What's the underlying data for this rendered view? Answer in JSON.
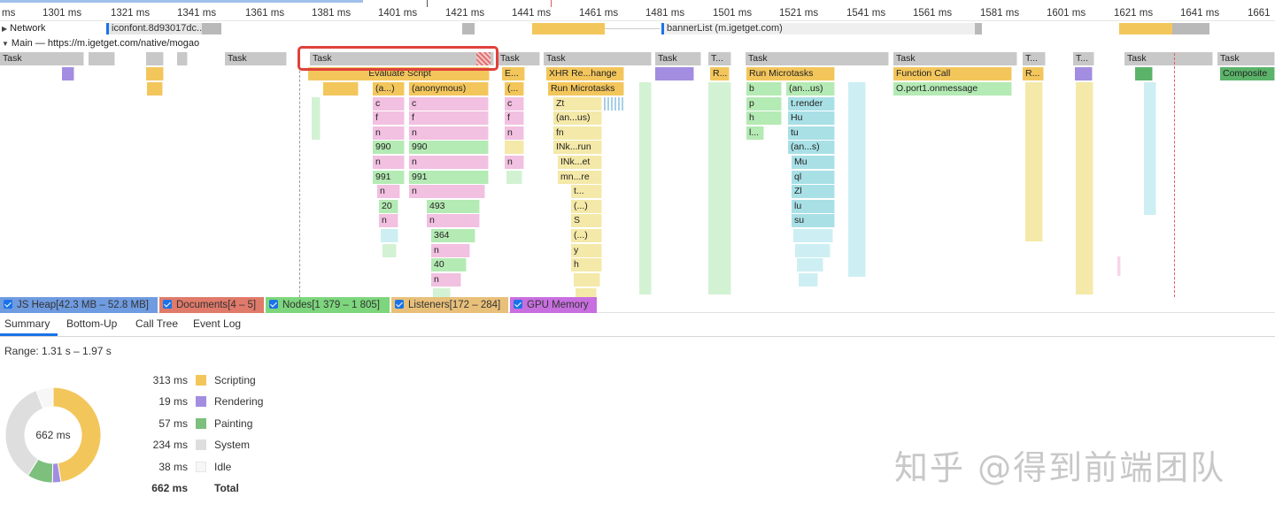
{
  "ruler": {
    "ticks": [
      "ms",
      "1301 ms",
      "1321 ms",
      "1341 ms",
      "1361 ms",
      "1381 ms",
      "1401 ms",
      "1421 ms",
      "1441 ms",
      "1461 ms",
      "1481 ms",
      "1501 ms",
      "1521 ms",
      "1541 ms",
      "1561 ms",
      "1581 ms",
      "1601 ms",
      "1621 ms",
      "1641 ms",
      "1661"
    ]
  },
  "tracks": {
    "network_label": "Network",
    "main_label": "Main — https://m.igetget.com/native/mogao"
  },
  "network": {
    "requests": [
      "iconfont.8d93017dc...",
      "bannerList (m.igetget.com)"
    ]
  },
  "flame": {
    "tasks": [
      "Task",
      "Task",
      "Task",
      "Task",
      "Task",
      "Task",
      "T...",
      "Task",
      "Task",
      "T...",
      "T...",
      "Task",
      "Task"
    ],
    "level1": [
      "Evaluate Script",
      "E...",
      "XHR Re...hange",
      "R...",
      "Run Microtasks",
      "Function Call",
      "R...",
      "Composite"
    ],
    "level2": [
      "(a...)",
      "(anonymous)",
      "(...",
      "Run Microtasks",
      "b",
      "(an...us)",
      "O.port1.onmessage"
    ],
    "col_a": [
      "c",
      "f",
      "n",
      "990",
      "n",
      "991",
      "n",
      "20",
      "n"
    ],
    "col_b": [
      "c",
      "f",
      "n",
      "990",
      "n",
      "991",
      "n",
      "493",
      "n",
      "364",
      "n",
      "40",
      "n"
    ],
    "col_c": [
      "c",
      "f",
      "n",
      "n"
    ],
    "col_d": [
      "Zt",
      "(an...us)",
      "fn",
      "INk...run",
      "INk...et",
      "mn...re",
      "t...",
      "(...)",
      "S",
      "(...)",
      "y",
      "h"
    ],
    "col_e": [
      "p",
      "h",
      "l..."
    ],
    "col_f": [
      "t.render",
      "Hu",
      "tu",
      "(an...s)",
      "Mu",
      "ql",
      "Zl",
      "lu",
      "su"
    ]
  },
  "memory": {
    "items": [
      "JS Heap[42.3 MB – 52.8 MB]",
      "Documents[4 – 5]",
      "Nodes[1 379 – 1 805]",
      "Listeners[172 – 284]",
      "GPU Memory"
    ],
    "colors": [
      "#6f9be0",
      "#e07a6a",
      "#7dd67d",
      "#e8c07a",
      "#c86fe0"
    ]
  },
  "tabs": [
    "Summary",
    "Bottom-Up",
    "Call Tree",
    "Event Log"
  ],
  "summary": {
    "range": "Range: 1.31 s – 1.97 s",
    "total_center": "662 ms",
    "rows": [
      {
        "value": "313 ms",
        "label": "Scripting",
        "color": "#f3c65c",
        "ms": 313
      },
      {
        "value": "19 ms",
        "label": "Rendering",
        "color": "#a38de0",
        "ms": 19
      },
      {
        "value": "57 ms",
        "label": "Painting",
        "color": "#7dbf7d",
        "ms": 57
      },
      {
        "value": "234 ms",
        "label": "System",
        "color": "#dedede",
        "ms": 234
      },
      {
        "value": "38 ms",
        "label": "Idle",
        "color": "#f7f7f7",
        "ms": 38
      }
    ],
    "total_value": "662 ms",
    "total_label": "Total"
  },
  "watermark": "知乎 @得到前端团队"
}
